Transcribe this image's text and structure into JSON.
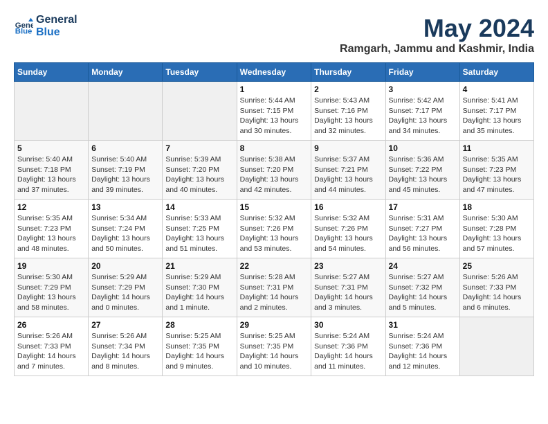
{
  "header": {
    "logo_line1": "General",
    "logo_line2": "Blue",
    "month_year": "May 2024",
    "location": "Ramgarh, Jammu and Kashmir, India"
  },
  "weekdays": [
    "Sunday",
    "Monday",
    "Tuesday",
    "Wednesday",
    "Thursday",
    "Friday",
    "Saturday"
  ],
  "weeks": [
    [
      {
        "day": "",
        "info": ""
      },
      {
        "day": "",
        "info": ""
      },
      {
        "day": "",
        "info": ""
      },
      {
        "day": "1",
        "info": "Sunrise: 5:44 AM\nSunset: 7:15 PM\nDaylight: 13 hours and 30 minutes."
      },
      {
        "day": "2",
        "info": "Sunrise: 5:43 AM\nSunset: 7:16 PM\nDaylight: 13 hours and 32 minutes."
      },
      {
        "day": "3",
        "info": "Sunrise: 5:42 AM\nSunset: 7:17 PM\nDaylight: 13 hours and 34 minutes."
      },
      {
        "day": "4",
        "info": "Sunrise: 5:41 AM\nSunset: 7:17 PM\nDaylight: 13 hours and 35 minutes."
      }
    ],
    [
      {
        "day": "5",
        "info": "Sunrise: 5:40 AM\nSunset: 7:18 PM\nDaylight: 13 hours and 37 minutes."
      },
      {
        "day": "6",
        "info": "Sunrise: 5:40 AM\nSunset: 7:19 PM\nDaylight: 13 hours and 39 minutes."
      },
      {
        "day": "7",
        "info": "Sunrise: 5:39 AM\nSunset: 7:20 PM\nDaylight: 13 hours and 40 minutes."
      },
      {
        "day": "8",
        "info": "Sunrise: 5:38 AM\nSunset: 7:20 PM\nDaylight: 13 hours and 42 minutes."
      },
      {
        "day": "9",
        "info": "Sunrise: 5:37 AM\nSunset: 7:21 PM\nDaylight: 13 hours and 44 minutes."
      },
      {
        "day": "10",
        "info": "Sunrise: 5:36 AM\nSunset: 7:22 PM\nDaylight: 13 hours and 45 minutes."
      },
      {
        "day": "11",
        "info": "Sunrise: 5:35 AM\nSunset: 7:23 PM\nDaylight: 13 hours and 47 minutes."
      }
    ],
    [
      {
        "day": "12",
        "info": "Sunrise: 5:35 AM\nSunset: 7:23 PM\nDaylight: 13 hours and 48 minutes."
      },
      {
        "day": "13",
        "info": "Sunrise: 5:34 AM\nSunset: 7:24 PM\nDaylight: 13 hours and 50 minutes."
      },
      {
        "day": "14",
        "info": "Sunrise: 5:33 AM\nSunset: 7:25 PM\nDaylight: 13 hours and 51 minutes."
      },
      {
        "day": "15",
        "info": "Sunrise: 5:32 AM\nSunset: 7:26 PM\nDaylight: 13 hours and 53 minutes."
      },
      {
        "day": "16",
        "info": "Sunrise: 5:32 AM\nSunset: 7:26 PM\nDaylight: 13 hours and 54 minutes."
      },
      {
        "day": "17",
        "info": "Sunrise: 5:31 AM\nSunset: 7:27 PM\nDaylight: 13 hours and 56 minutes."
      },
      {
        "day": "18",
        "info": "Sunrise: 5:30 AM\nSunset: 7:28 PM\nDaylight: 13 hours and 57 minutes."
      }
    ],
    [
      {
        "day": "19",
        "info": "Sunrise: 5:30 AM\nSunset: 7:29 PM\nDaylight: 13 hours and 58 minutes."
      },
      {
        "day": "20",
        "info": "Sunrise: 5:29 AM\nSunset: 7:29 PM\nDaylight: 14 hours and 0 minutes."
      },
      {
        "day": "21",
        "info": "Sunrise: 5:29 AM\nSunset: 7:30 PM\nDaylight: 14 hours and 1 minute."
      },
      {
        "day": "22",
        "info": "Sunrise: 5:28 AM\nSunset: 7:31 PM\nDaylight: 14 hours and 2 minutes."
      },
      {
        "day": "23",
        "info": "Sunrise: 5:27 AM\nSunset: 7:31 PM\nDaylight: 14 hours and 3 minutes."
      },
      {
        "day": "24",
        "info": "Sunrise: 5:27 AM\nSunset: 7:32 PM\nDaylight: 14 hours and 5 minutes."
      },
      {
        "day": "25",
        "info": "Sunrise: 5:26 AM\nSunset: 7:33 PM\nDaylight: 14 hours and 6 minutes."
      }
    ],
    [
      {
        "day": "26",
        "info": "Sunrise: 5:26 AM\nSunset: 7:33 PM\nDaylight: 14 hours and 7 minutes."
      },
      {
        "day": "27",
        "info": "Sunrise: 5:26 AM\nSunset: 7:34 PM\nDaylight: 14 hours and 8 minutes."
      },
      {
        "day": "28",
        "info": "Sunrise: 5:25 AM\nSunset: 7:35 PM\nDaylight: 14 hours and 9 minutes."
      },
      {
        "day": "29",
        "info": "Sunrise: 5:25 AM\nSunset: 7:35 PM\nDaylight: 14 hours and 10 minutes."
      },
      {
        "day": "30",
        "info": "Sunrise: 5:24 AM\nSunset: 7:36 PM\nDaylight: 14 hours and 11 minutes."
      },
      {
        "day": "31",
        "info": "Sunrise: 5:24 AM\nSunset: 7:36 PM\nDaylight: 14 hours and 12 minutes."
      },
      {
        "day": "",
        "info": ""
      }
    ]
  ]
}
